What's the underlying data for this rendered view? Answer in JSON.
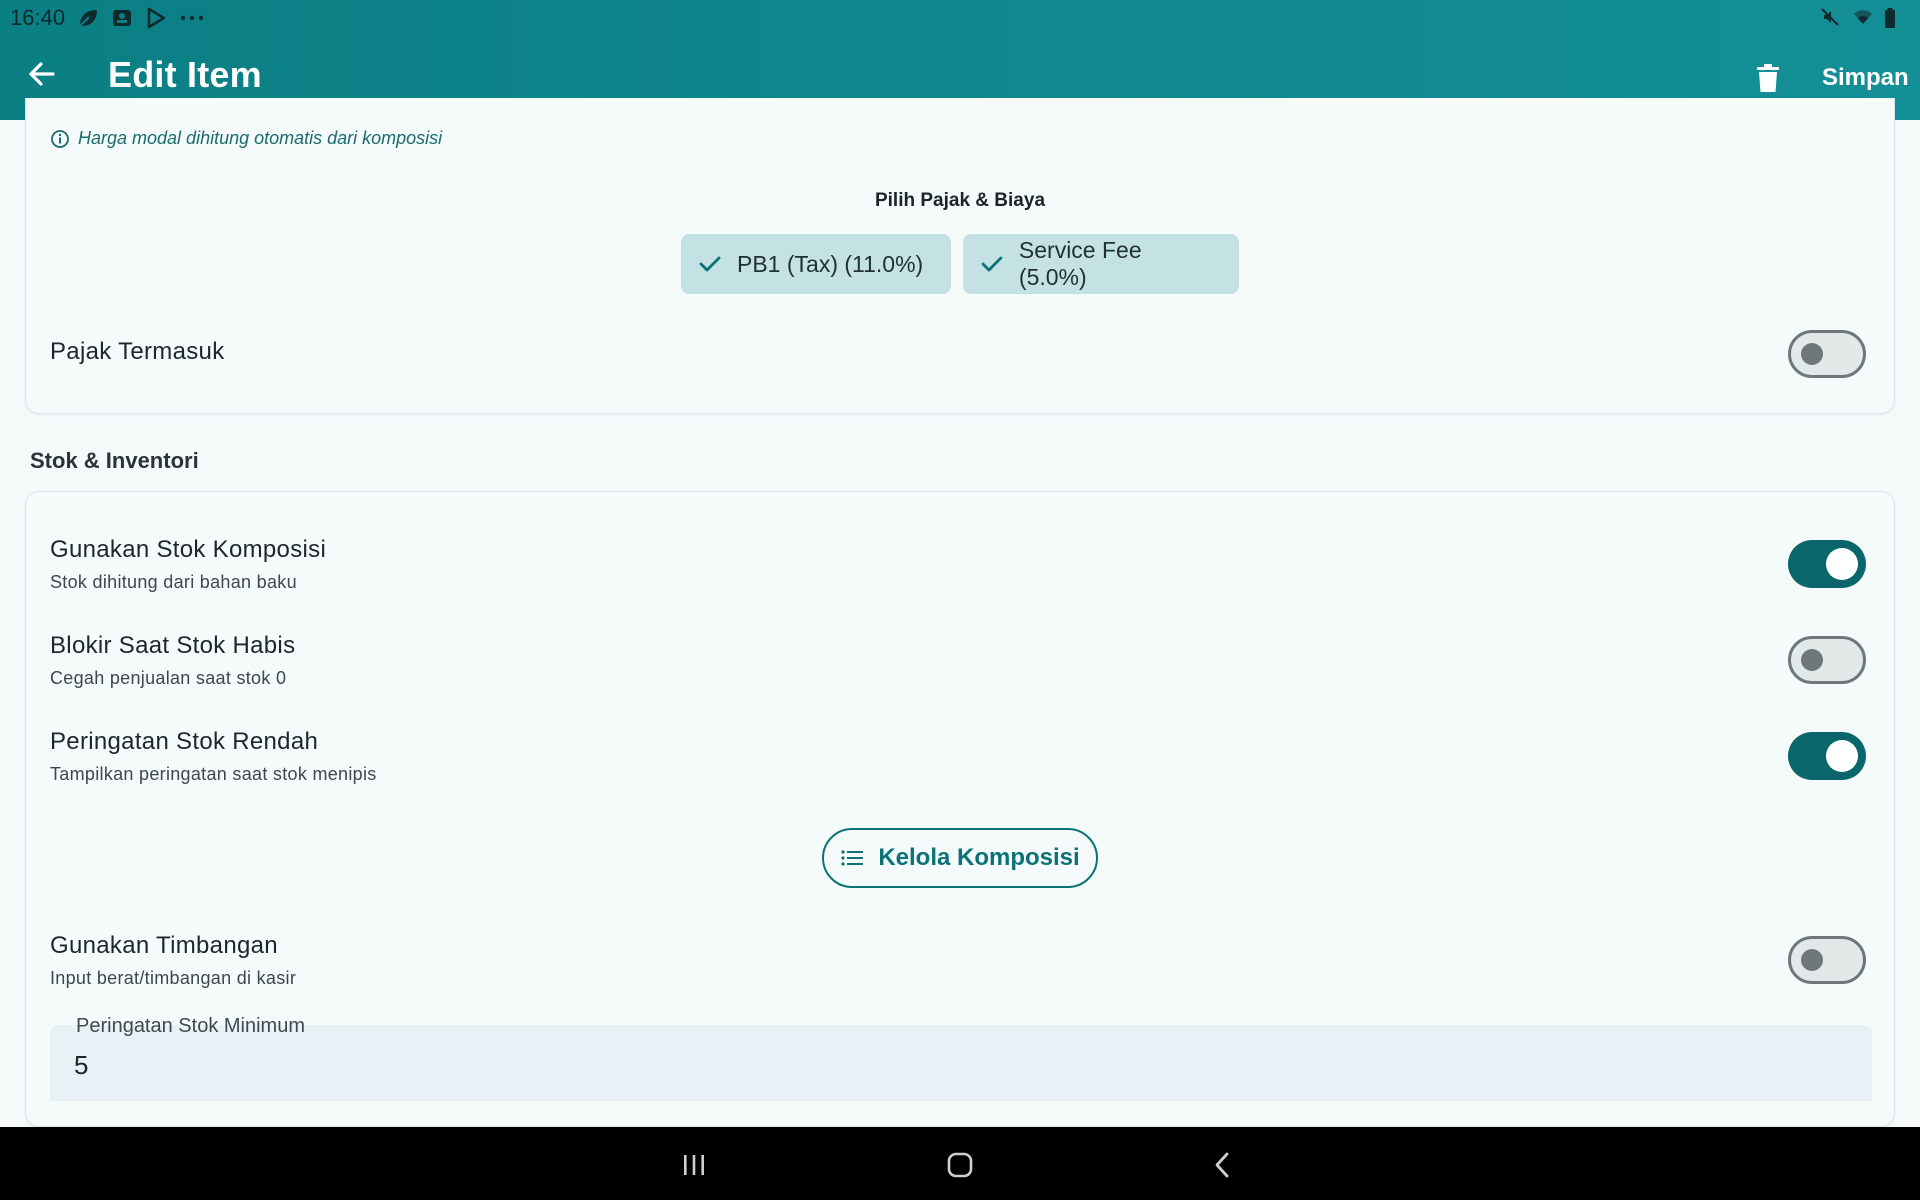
{
  "status_bar": {
    "time": "16:40",
    "left_icons": [
      "leaf-icon",
      "app-badge-icon",
      "play-store-icon",
      "more-dots-icon"
    ],
    "right_icons": [
      "mute-icon",
      "wifi-icon",
      "battery-icon"
    ]
  },
  "app_bar": {
    "title": "Edit Item",
    "save_label": "Simpan",
    "back_icon": "arrow-back-icon",
    "delete_icon": "trash-icon",
    "color": "#0a7f84"
  },
  "pricing_card": {
    "info_text": "Harga modal dihitung otomatis dari komposisi",
    "tax_section_title": "Pilih Pajak & Biaya",
    "tax_chips": [
      {
        "label": "PB1 (Tax) (11.0%)",
        "selected": true
      },
      {
        "label": "Service Fee (5.0%)",
        "selected": true
      }
    ],
    "tax_inclusive": {
      "label": "Pajak Termasuk",
      "on": false
    }
  },
  "stock_section": {
    "title": "Stok & Inventori",
    "toggles": [
      {
        "label": "Gunakan Stok Komposisi",
        "sub": "Stok dihitung dari bahan baku",
        "on": true
      },
      {
        "label": "Blokir Saat Stok Habis",
        "sub": "Cegah penjualan saat stok 0",
        "on": false
      },
      {
        "label": "Peringatan Stok Rendah",
        "sub": "Tampilkan peringatan saat stok menipis",
        "on": true
      }
    ],
    "manage_button_label": "Kelola Komposisi",
    "scale_toggle": {
      "label": "Gunakan Timbangan",
      "sub": "Input berat/timbangan di kasir",
      "on": false
    },
    "min_stock_field": {
      "label": "Peringatan Stok Minimum",
      "value": "5"
    }
  },
  "nav_bar": {
    "icons": [
      "recents-icon",
      "home-icon",
      "back-nav-icon"
    ]
  },
  "colors": {
    "primary": "#0b7378",
    "toggle_on": "#09666b",
    "chip_bg": "#c4e2e4",
    "nav_bg": "#000000"
  }
}
